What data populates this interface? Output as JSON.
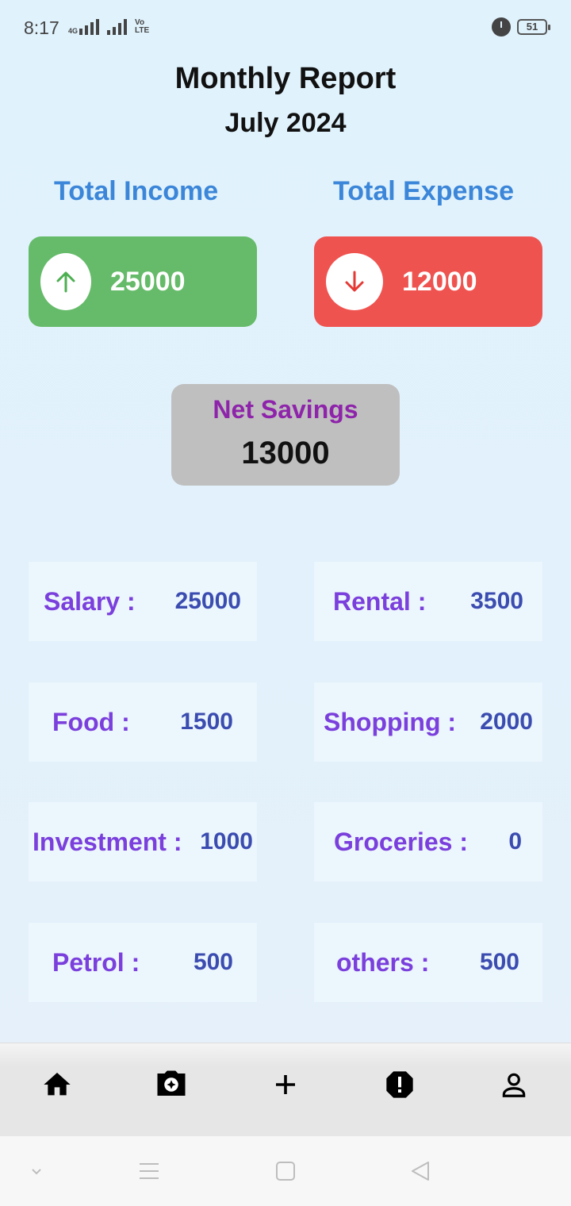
{
  "status_bar": {
    "time": "8:17",
    "network_label": "4G",
    "volte_label": "Vo LTE",
    "battery": "51",
    "icons": [
      "signal-4g-icon",
      "signal-icon",
      "volte-icon",
      "alarm-icon",
      "battery-icon"
    ]
  },
  "header": {
    "title": "Monthly Report",
    "subtitle": "July 2024"
  },
  "summary": {
    "income_label": "Total Income",
    "income_value": "25000",
    "income_icon": "arrow-up-icon",
    "expense_label": "Total Expense",
    "expense_value": "12000",
    "expense_icon": "arrow-down-icon",
    "savings_label": "Net Savings",
    "savings_value": "13000"
  },
  "categories": [
    {
      "label": "Salary :",
      "value": "25000"
    },
    {
      "label": "Rental :",
      "value": "3500"
    },
    {
      "label": "Food :",
      "value": "1500"
    },
    {
      "label": "Shopping :",
      "value": "2000"
    },
    {
      "label": "Investment :",
      "value": "1000"
    },
    {
      "label": "Groceries :",
      "value": "0"
    },
    {
      "label": "Petrol :",
      "value": "500"
    },
    {
      "label": "others :",
      "value": "500"
    }
  ],
  "bottom_nav": {
    "items": [
      "home-icon",
      "camera-icon",
      "add-icon",
      "alert-icon",
      "profile-icon"
    ]
  },
  "colors": {
    "background": "#e0f2fc",
    "income": "#66bb6a",
    "expense": "#ef5350",
    "heading_blue": "#3b86d9",
    "savings_card": "#bfbfbf",
    "savings_label": "#8e24aa",
    "category_label": "#7a3fdc",
    "category_value": "#3b4cb0"
  }
}
